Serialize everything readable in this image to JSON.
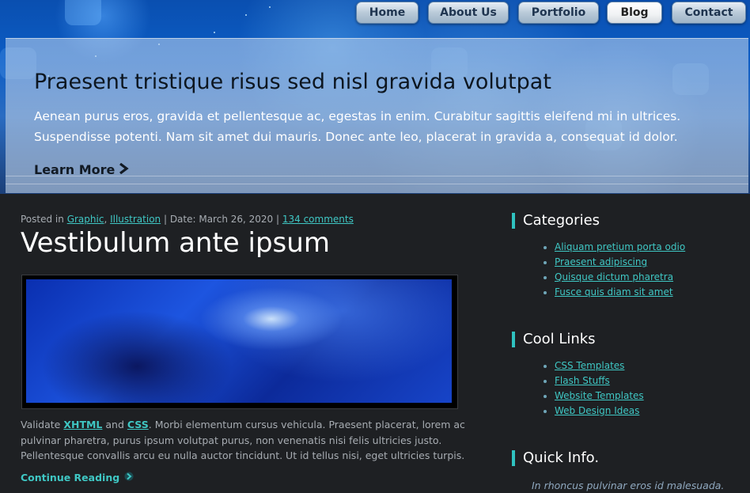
{
  "nav": {
    "items": [
      {
        "label": "Home"
      },
      {
        "label": "About Us"
      },
      {
        "label": "Portfolio"
      },
      {
        "label": "Blog"
      },
      {
        "label": "Contact"
      }
    ],
    "active": "Blog"
  },
  "hero": {
    "title": "Praesent tristique risus sed nisl gravida volutpat",
    "text": "Aenean purus eros, gravida et pellentesque ac, egestas in enim. Curabitur sagittis eleifend mi in ultrices. Suspendisse potenti. Nam sit amet dui mauris. Donec ante leo, placerat in gravida a, consequat id dolor.",
    "learn_more": "Learn More",
    "learn_more_icon": "chevron-right-icon"
  },
  "post": {
    "meta_prefix": "Posted in",
    "category_1": "Graphic",
    "category_2": "Illustration",
    "date_label": "Date: March 26, 2020",
    "comments": "134 comments",
    "title": "Vestibulum ante ipsum",
    "body_prefix": "Validate",
    "xhtml": "XHTML",
    "and": "and",
    "css": "CSS",
    "body_rest": ". Morbi elementum cursus vehicula. Praesent placerat, lorem ac pulvinar pharetra, purus ipsum volutpat purus, non venenatis nisi felis ultricies justo. Pellentesque convallis arcu eu nulla auctor tincidunt. Ut id tellus nisi, eget ultricies turpis.",
    "continue": "Continue Reading",
    "continue_icon": "arrow-right-icon"
  },
  "sidebar": {
    "categories": {
      "title": "Categories",
      "items": [
        "Aliquam pretium porta odio",
        "Praesent adipiscing",
        "Quisque dictum pharetra",
        "Fusce quis diam sit amet"
      ]
    },
    "cool_links": {
      "title": "Cool Links",
      "items": [
        "CSS Templates",
        "Flash Stuffs",
        "Website Templates",
        "Web Design Ideas"
      ]
    },
    "quick_info": {
      "title": "Quick Info.",
      "text": "In rhoncus pulvinar eros id malesuada."
    }
  },
  "colors": {
    "accent": "#3fc7c4",
    "background": "#1e2023",
    "hero_blue": "#0c5cc4"
  }
}
